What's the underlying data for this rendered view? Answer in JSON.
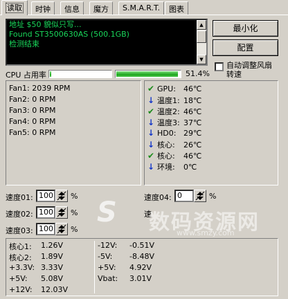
{
  "tabs": [
    "读取",
    "时钟",
    "信息",
    "魔方",
    "S.M.A.R.T.",
    "图表"
  ],
  "log": {
    "lines": [
      "地址 $50 貌似只写...",
      "Found ST3500630AS (500.1GB)",
      "检测结束"
    ]
  },
  "buttons": {
    "minimize": "最小化",
    "config": "配置"
  },
  "auto_fan": {
    "label_line1": "自动调整风扇",
    "label_line2": "转速",
    "checked": false
  },
  "cpu": {
    "label": "CPU 占用率",
    "percent_text": "51.4%",
    "bar1": 0.02,
    "bar2": 0.97
  },
  "fans": [
    "Fan1: 2039 RPM",
    "Fan2: 0 RPM",
    "Fan3: 0 RPM",
    "Fan4: 0 RPM",
    "Fan5: 0 RPM"
  ],
  "temps": [
    {
      "icon": "check-icon",
      "label": "GPU:",
      "value": "46℃"
    },
    {
      "icon": "down-arrow-icon",
      "label": "温度1:",
      "value": "18℃"
    },
    {
      "icon": "check-icon",
      "label": "温度2:",
      "value": "46℃"
    },
    {
      "icon": "down-arrow-icon",
      "label": "温度3:",
      "value": "37℃"
    },
    {
      "icon": "down-arrow-icon",
      "label": "HD0:",
      "value": "29℃"
    },
    {
      "icon": "down-arrow-icon",
      "label": "核心:",
      "value": "26℃"
    },
    {
      "icon": "check-icon",
      "label": "核心:",
      "value": "46℃"
    },
    {
      "icon": "down-arrow-icon",
      "label": "环境:",
      "value": "0℃"
    }
  ],
  "speeds": [
    {
      "label": "速度01:",
      "value": "100",
      "unit": "%"
    },
    {
      "label": "速度02:",
      "value": "100",
      "unit": "%"
    },
    {
      "label": "速度03:",
      "value": "100",
      "unit": "%"
    },
    {
      "label": "速度04:",
      "value": "0",
      "unit": "%"
    },
    {
      "label": "速",
      "value": "",
      "unit": ""
    }
  ],
  "voltages_left": [
    {
      "label": "核心1:",
      "value": "1.26V"
    },
    {
      "label": "核心2:",
      "value": "1.89V"
    },
    {
      "label": "+3.3V:",
      "value": "3.33V"
    },
    {
      "label": "+5V:",
      "value": "5.08V"
    },
    {
      "label": "+12V:",
      "value": "12.03V"
    }
  ],
  "voltages_right": [
    {
      "label": "-12V:",
      "value": "-0.51V"
    },
    {
      "label": "-5V:",
      "value": "-8.48V"
    },
    {
      "label": "+5V:",
      "value": "4.92V"
    },
    {
      "label": "Vbat:",
      "value": "3.01V"
    }
  ],
  "watermark": {
    "text": "数码资源网",
    "url": "www.smzy.com"
  }
}
